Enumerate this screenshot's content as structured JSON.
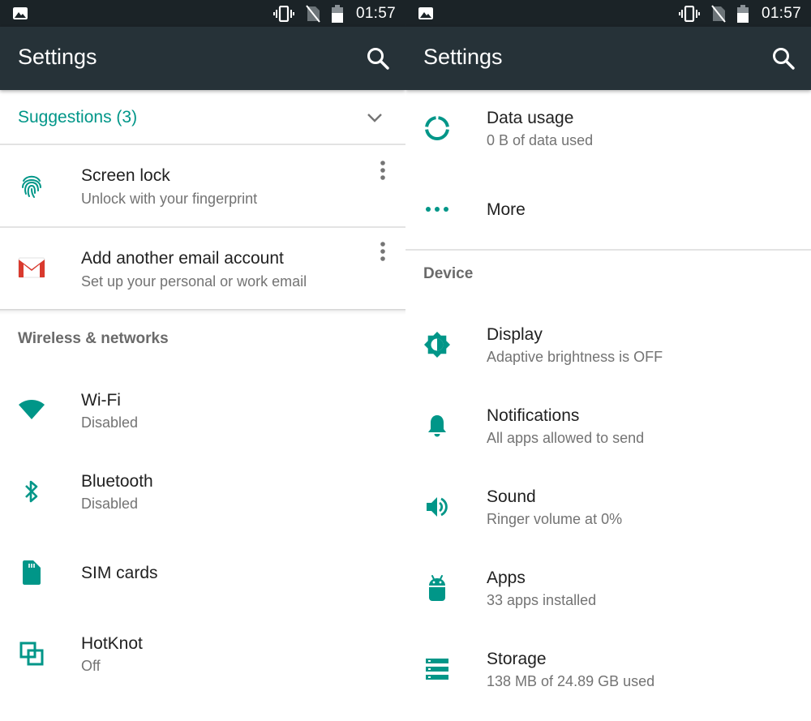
{
  "status_bar": {
    "time": "01:57"
  },
  "colors": {
    "accent": "#009688",
    "toolbar": "#263238",
    "status_bar": "#1b2327"
  },
  "left": {
    "title": "Settings",
    "suggestions_label": "Suggestions (3)",
    "suggestions": [
      {
        "title": "Screen lock",
        "summary": "Unlock with your fingerprint",
        "icon": "fingerprint-icon"
      },
      {
        "title": "Add another email account",
        "summary": "Set up your personal or work email",
        "icon": "gmail-icon"
      }
    ],
    "category": "Wireless & networks",
    "items": [
      {
        "title": "Wi-Fi",
        "summary": "Disabled",
        "icon": "wifi-icon"
      },
      {
        "title": "Bluetooth",
        "summary": "Disabled",
        "icon": "bluetooth-icon"
      },
      {
        "title": "SIM cards",
        "summary": "",
        "icon": "sim-card-icon"
      },
      {
        "title": "HotKnot",
        "summary": "Off",
        "icon": "hotknot-icon"
      }
    ]
  },
  "right": {
    "title": "Settings",
    "items_top": [
      {
        "title": "Data usage",
        "summary": "0 B of data used",
        "icon": "data-usage-icon"
      },
      {
        "title": "More",
        "summary": "",
        "icon": "more-horiz-icon"
      }
    ],
    "category": "Device",
    "items": [
      {
        "title": "Display",
        "summary": "Adaptive brightness is OFF",
        "icon": "brightness-icon"
      },
      {
        "title": "Notifications",
        "summary": "All apps allowed to send",
        "icon": "bell-icon"
      },
      {
        "title": "Sound",
        "summary": "Ringer volume at 0%",
        "icon": "volume-icon"
      },
      {
        "title": "Apps",
        "summary": "33 apps installed",
        "icon": "android-icon"
      },
      {
        "title": "Storage",
        "summary": "138 MB of 24.89 GB used",
        "icon": "storage-icon"
      }
    ]
  }
}
